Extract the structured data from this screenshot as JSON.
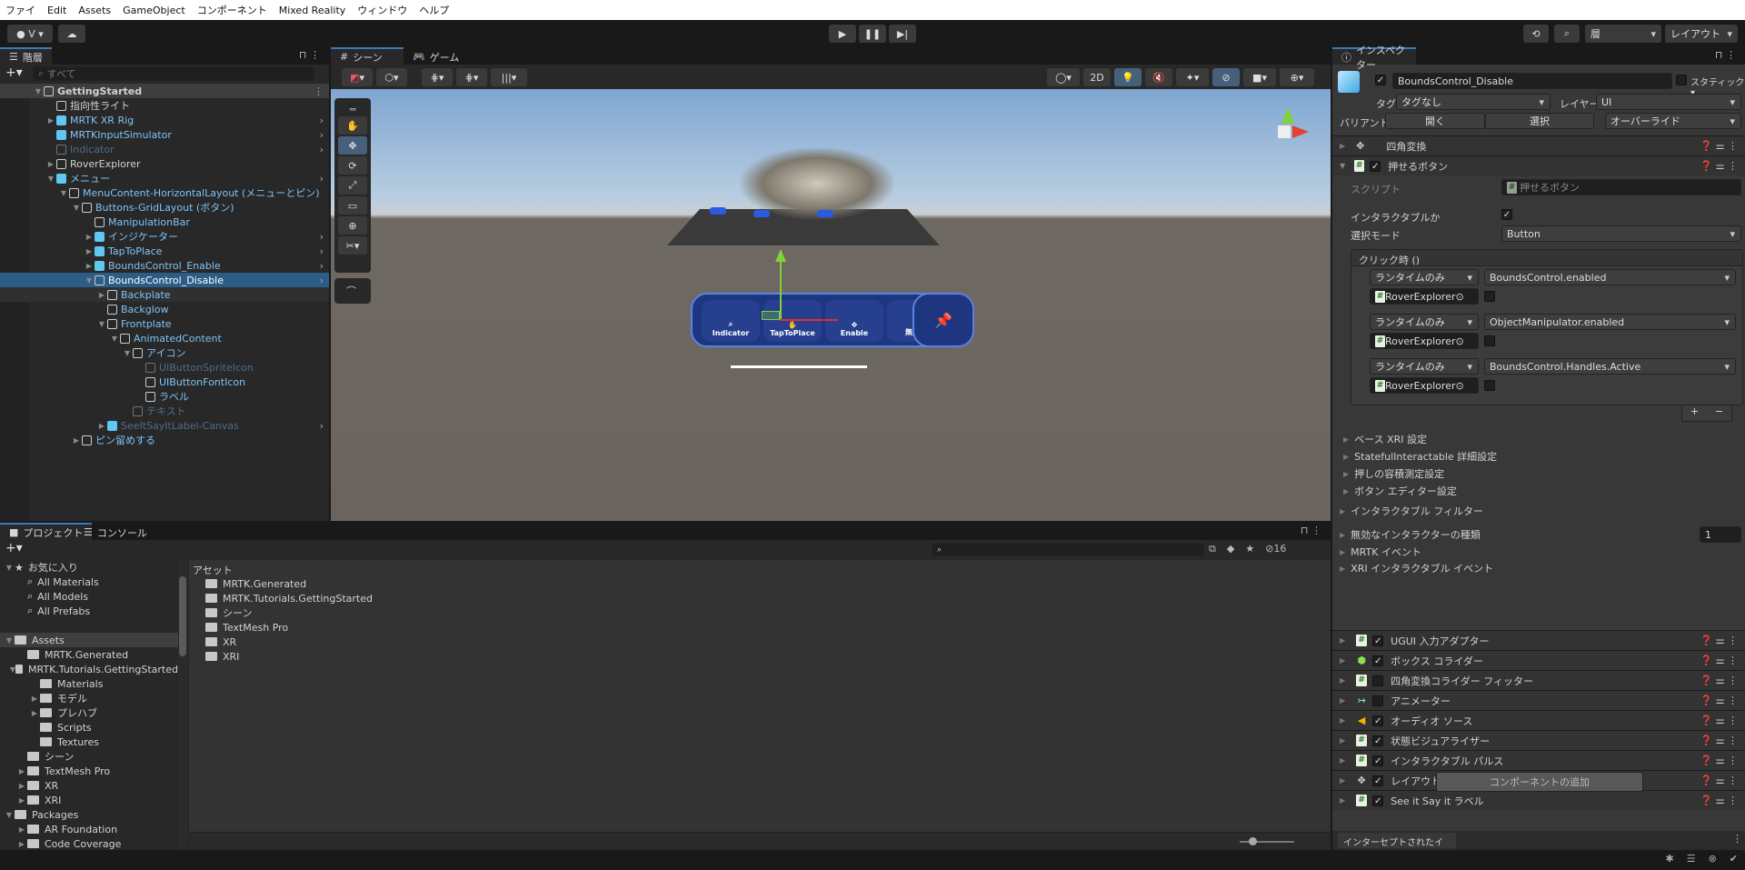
{
  "menu": [
    "ファイ",
    "Edit",
    "Assets",
    "GameObject",
    "コンポーネント",
    "Mixed Reality",
    "ウィンドウ",
    "ヘルプ"
  ],
  "toolbar": {
    "account": "V",
    "layers": "層",
    "layout": "レイアウト"
  },
  "hierarchy": {
    "tab": "階層",
    "search_placeholder": "すべて",
    "rows": [
      {
        "t": "GettingStarted",
        "d": 0,
        "i": "unity",
        "a": "▼",
        "c": "#d2d2d2",
        "scene": true
      },
      {
        "t": "指向性ライト",
        "d": 1,
        "i": "cube",
        "a": "",
        "c": "#d2d2d2"
      },
      {
        "t": "MRTK XR Rig",
        "d": 1,
        "i": "blue",
        "a": "▶",
        "c": "#7fc3f5",
        "ch": true
      },
      {
        "t": "MRTKInputSimulator",
        "d": 1,
        "i": "blue",
        "a": "",
        "c": "#7fc3f5",
        "ch": true
      },
      {
        "t": "Indicator",
        "d": 1,
        "i": "dim",
        "a": "",
        "c": "#4e6b8a",
        "ch": true
      },
      {
        "t": "RoverExplorer",
        "d": 1,
        "i": "cube",
        "a": "▶",
        "c": "#d2d2d2"
      },
      {
        "t": "メニュー",
        "d": 1,
        "i": "blue",
        "a": "▼",
        "c": "#7fc3f5",
        "ch": true
      },
      {
        "t": "MenuContent-HorizontalLayout (メニューとピン)",
        "d": 2,
        "i": "cube",
        "a": "▼",
        "c": "#7fc3f5"
      },
      {
        "t": "Buttons-GridLayout (ボタン)",
        "d": 3,
        "i": "cube",
        "a": "▼",
        "c": "#7fc3f5"
      },
      {
        "t": "ManipulationBar",
        "d": 4,
        "i": "cube",
        "a": "",
        "c": "#7fc3f5"
      },
      {
        "t": "インジケーター",
        "d": 4,
        "i": "blue",
        "a": "▶",
        "c": "#7fc3f5",
        "ch": true
      },
      {
        "t": "TapToPlace",
        "d": 4,
        "i": "blue",
        "a": "▶",
        "c": "#7fc3f5",
        "ch": true
      },
      {
        "t": "BoundsControl_Enable",
        "d": 4,
        "i": "blue",
        "a": "▶",
        "c": "#7fc3f5",
        "ch": true
      },
      {
        "t": "BoundsControl_Disable",
        "d": 4,
        "i": "cube",
        "a": "▼",
        "c": "#ffffff",
        "ch": true,
        "sel": true
      },
      {
        "t": "Backplate",
        "d": 5,
        "i": "cube",
        "a": "▶",
        "c": "#7fc3f5",
        "hov": true
      },
      {
        "t": "Backglow",
        "d": 5,
        "i": "cube",
        "a": "",
        "c": "#7fc3f5"
      },
      {
        "t": "Frontplate",
        "d": 5,
        "i": "cube",
        "a": "▼",
        "c": "#7fc3f5"
      },
      {
        "t": "AnimatedContent",
        "d": 6,
        "i": "cube",
        "a": "▼",
        "c": "#7fc3f5"
      },
      {
        "t": "アイコン",
        "d": 7,
        "i": "cube",
        "a": "▼",
        "c": "#7fc3f5"
      },
      {
        "t": "UIButtonSpriteIcon",
        "d": 8,
        "i": "dim",
        "a": "",
        "c": "#4e6b8a"
      },
      {
        "t": "UIButtonFontIcon",
        "d": 8,
        "i": "cube",
        "a": "",
        "c": "#7fc3f5"
      },
      {
        "t": "ラベル",
        "d": 8,
        "i": "cube",
        "a": "",
        "c": "#7fc3f5"
      },
      {
        "t": "テキスト",
        "d": 7,
        "i": "dim",
        "a": "",
        "c": "#4e6b8a"
      },
      {
        "t": "SeeItSayItLabel-Canvas",
        "d": 5,
        "i": "blue",
        "a": "▶",
        "c": "#4e6b8a",
        "ch": true
      },
      {
        "t": "ピン留めする",
        "d": 3,
        "i": "cube",
        "a": "▶",
        "c": "#7fc3f5"
      }
    ]
  },
  "scene": {
    "tab_scene": "シーン",
    "tab_game": "ゲーム",
    "mode_2d": "2D",
    "menu_buttons": [
      "Indicator",
      "TapToPlace",
      "Enable",
      "無効化"
    ]
  },
  "inspector": {
    "tab": "インスペクター",
    "object_name": "BoundsControl_Disable",
    "static": "スタティック",
    "tag_label": "タグ",
    "tag": "タグなし",
    "layer_label": "レイヤー",
    "layer": "UI",
    "variant_label": "バリアント",
    "open": "開く",
    "select": "選択",
    "override": "オーバーライド",
    "rect_transform": "四角変換",
    "pressable": "押せるボタン",
    "script_label": "スクリプト",
    "script_value": "押せるボタン",
    "interactable_label": "インタラクタブルか",
    "select_mode_label": "選択モード",
    "select_mode": "Button",
    "on_click": "クリック時 ()",
    "events": [
      {
        "mode": "ランタイムのみ",
        "func": "BoundsControl.enabled",
        "target": "RoverExplorer"
      },
      {
        "mode": "ランタイムのみ",
        "func": "ObjectManipulator.enabled",
        "target": "RoverExplorer"
      },
      {
        "mode": "ランタイムのみ",
        "func": "BoundsControl.Handles.Active",
        "target": "RoverExplorer"
      }
    ],
    "foldouts": [
      "ベース XRI 設定",
      "StatefulInteractable 詳細設定",
      "押しの容積測定設定",
      "ボタン エディター設定"
    ],
    "filter": "インタラクタブル フィルター",
    "disabled_types": "無効なインタラクターの種類",
    "disabled_count": "1",
    "mrtk_events": "MRTK イベント",
    "xri_events": "XRI インタラクタブル イベント",
    "components": [
      {
        "n": "UGUI 入力アダプター",
        "on": true,
        "ic": "hash"
      },
      {
        "n": "ボックス コライダー",
        "on": true,
        "ic": "box"
      },
      {
        "n": "四角変換コライダー フィッター",
        "on": false,
        "ic": "hash"
      },
      {
        "n": "アニメーター",
        "on": false,
        "ic": "anim"
      },
      {
        "n": "オーディオ ソース",
        "on": true,
        "ic": "audio"
      },
      {
        "n": "状態ビジュアライザー",
        "on": true,
        "ic": "hash"
      },
      {
        "n": "インタラクタブル パルス",
        "on": true,
        "ic": "hash"
      },
      {
        "n": "レイアウト要素",
        "on": true,
        "ic": "layout"
      },
      {
        "n": "See it Say it ラベル",
        "on": true,
        "ic": "hash"
      }
    ],
    "add_component": "コンポーネントの追加",
    "intercepted": "インターセプトされたイベント"
  },
  "project": {
    "tab_project": "プロジェクト",
    "tab_console": "コンソール",
    "hidden_count": "16",
    "breadcrumb": "アセット",
    "tree": [
      {
        "t": "お気に入り",
        "d": 0,
        "k": "star",
        "a": "▼"
      },
      {
        "t": "All Materials",
        "d": 1,
        "k": "search"
      },
      {
        "t": "All Models",
        "d": 1,
        "k": "search"
      },
      {
        "t": "All Prefabs",
        "d": 1,
        "k": "search"
      },
      {
        "t": "",
        "d": 0,
        "k": "gap"
      },
      {
        "t": "Assets",
        "d": 0,
        "k": "folder",
        "a": "▼",
        "sel": true
      },
      {
        "t": "MRTK.Generated",
        "d": 1,
        "k": "folder"
      },
      {
        "t": "MRTK.Tutorials.GettingStarted",
        "d": 1,
        "k": "folder",
        "a": "▼"
      },
      {
        "t": "Materials",
        "d": 2,
        "k": "folder"
      },
      {
        "t": "モデル",
        "d": 2,
        "k": "folder",
        "a": "▶"
      },
      {
        "t": "プレハブ",
        "d": 2,
        "k": "folder",
        "a": "▶"
      },
      {
        "t": "Scripts",
        "d": 2,
        "k": "folder"
      },
      {
        "t": "Textures",
        "d": 2,
        "k": "folder"
      },
      {
        "t": "シーン",
        "d": 1,
        "k": "folder"
      },
      {
        "t": "TextMesh Pro",
        "d": 1,
        "k": "folder",
        "a": "▶"
      },
      {
        "t": "XR",
        "d": 1,
        "k": "folder",
        "a": "▶"
      },
      {
        "t": "XRI",
        "d": 1,
        "k": "folder",
        "a": "▶"
      },
      {
        "t": "Packages",
        "d": 0,
        "k": "folder",
        "a": "▼"
      },
      {
        "t": "AR Foundation",
        "d": 1,
        "k": "folder",
        "a": "▶"
      },
      {
        "t": "Code Coverage",
        "d": 1,
        "k": "folder",
        "a": "▶"
      }
    ],
    "assets": [
      "MRTK.Generated",
      "MRTK.Tutorials.GettingStarted",
      "シーン",
      "TextMesh Pro",
      "XR",
      "XRI"
    ]
  }
}
